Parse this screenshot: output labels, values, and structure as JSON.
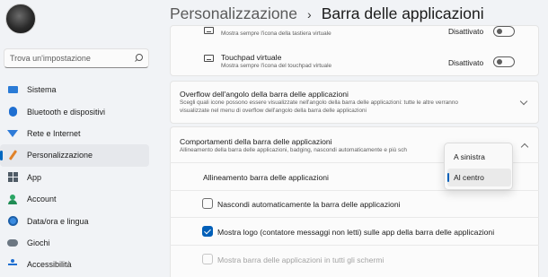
{
  "search": {
    "placeholder": "Trova un'impostazione",
    "icon": "search-icon"
  },
  "sidebar": {
    "items": [
      {
        "label": "Sistema",
        "icon": "system-icon"
      },
      {
        "label": "Bluetooth e dispositivi",
        "icon": "bluetooth-icon"
      },
      {
        "label": "Rete e Internet",
        "icon": "network-icon"
      },
      {
        "label": "Personalizzazione",
        "icon": "brush-icon",
        "active": true
      },
      {
        "label": "App",
        "icon": "apps-icon"
      },
      {
        "label": "Account",
        "icon": "account-icon"
      },
      {
        "label": "Data/ora e lingua",
        "icon": "globe-icon"
      },
      {
        "label": "Giochi",
        "icon": "gamepad-icon"
      },
      {
        "label": "Accessibilità",
        "icon": "accessibility-icon"
      }
    ]
  },
  "header": {
    "parent": "Personalizzazione",
    "separator": "›",
    "current": "Barra delle applicazioni"
  },
  "touch_keyboard": {
    "subtitle": "Mostra sempre l'icona della tastiera virtuale",
    "state": "Disattivato"
  },
  "touchpad": {
    "title": "Touchpad virtuale",
    "subtitle": "Mostra sempre l'icona del touchpad virtuale",
    "state": "Disattivato"
  },
  "overflow": {
    "title": "Overflow dell'angolo della barra delle applicazioni",
    "subtitle_1": "Scegli quali icone possono essere visualizzate nell'angolo della barra delle applicazioni: tutte le altre verranno",
    "subtitle_2": "visualizzate nel menu di overflow dell'angolo della barra delle applicazioni"
  },
  "behaviors": {
    "title": "Comportamenti della barra delle applicazioni",
    "subtitle": "Allineamento della barra delle applicazioni, badging, nascondi automaticamente e più sch",
    "alignment_label": "Allineamento barra delle applicazioni",
    "options": [
      {
        "label": "Nascondi automaticamente la barra delle applicazioni",
        "checked": false,
        "disabled": false
      },
      {
        "label": "Mostra logo (contatore messaggi non letti) sulle app della barra delle applicazioni",
        "checked": true,
        "disabled": false
      },
      {
        "label": "Mostra barra delle applicazioni in tutti gli schermi",
        "checked": false,
        "disabled": true
      }
    ]
  },
  "dropdown": {
    "options": [
      "A sinistra",
      "Al centro"
    ],
    "selected": "Al centro"
  },
  "colors": {
    "accent": "#005fb8",
    "background": "#f1f3f6",
    "card": "#fbfbfb"
  }
}
